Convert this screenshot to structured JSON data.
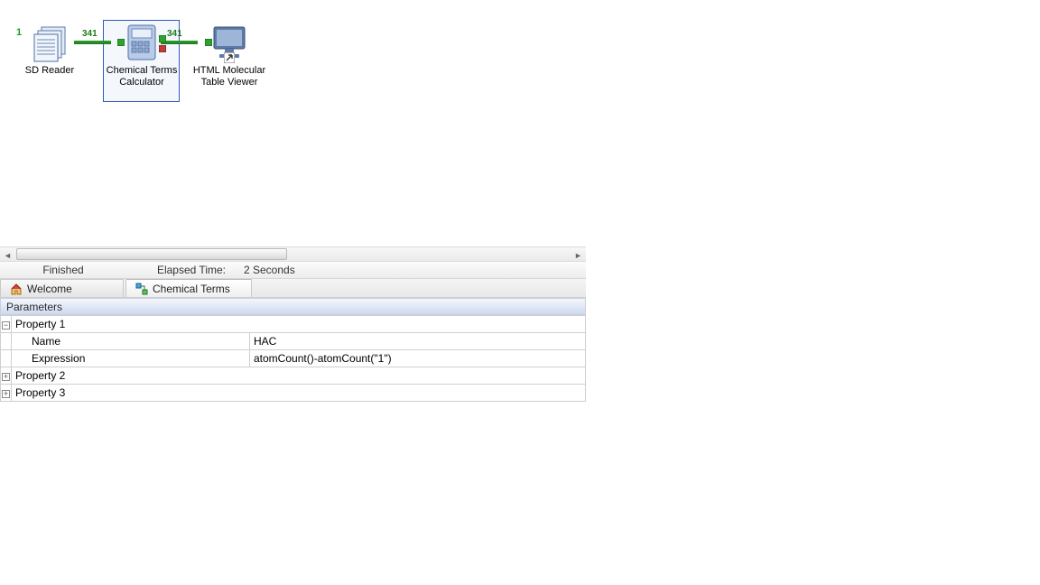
{
  "canvas": {
    "annotation_1": "1",
    "connection_count_left": "341",
    "connection_count_right": "341",
    "nodes": {
      "sd_reader": {
        "label": "SD Reader"
      },
      "calc": {
        "label_line1": "Chemical Terms",
        "label_line2": "Calculator"
      },
      "viewer": {
        "label_line1": "HTML Molecular",
        "label_line2": "Table Viewer"
      }
    }
  },
  "status": {
    "state": "Finished",
    "elapsed_label": "Elapsed Time:",
    "elapsed_value": "2 Seconds"
  },
  "tabs": {
    "welcome": "Welcome",
    "chemical_terms": "Chemical Terms"
  },
  "parameters": {
    "header": "Parameters",
    "prop1": {
      "label": "Property 1",
      "name_key": "Name",
      "name_val": "HAC",
      "expr_key": "Expression",
      "expr_val": "atomCount()-atomCount(\"1\")"
    },
    "prop2": {
      "label": "Property 2"
    },
    "prop3": {
      "label": "Property 3"
    }
  }
}
